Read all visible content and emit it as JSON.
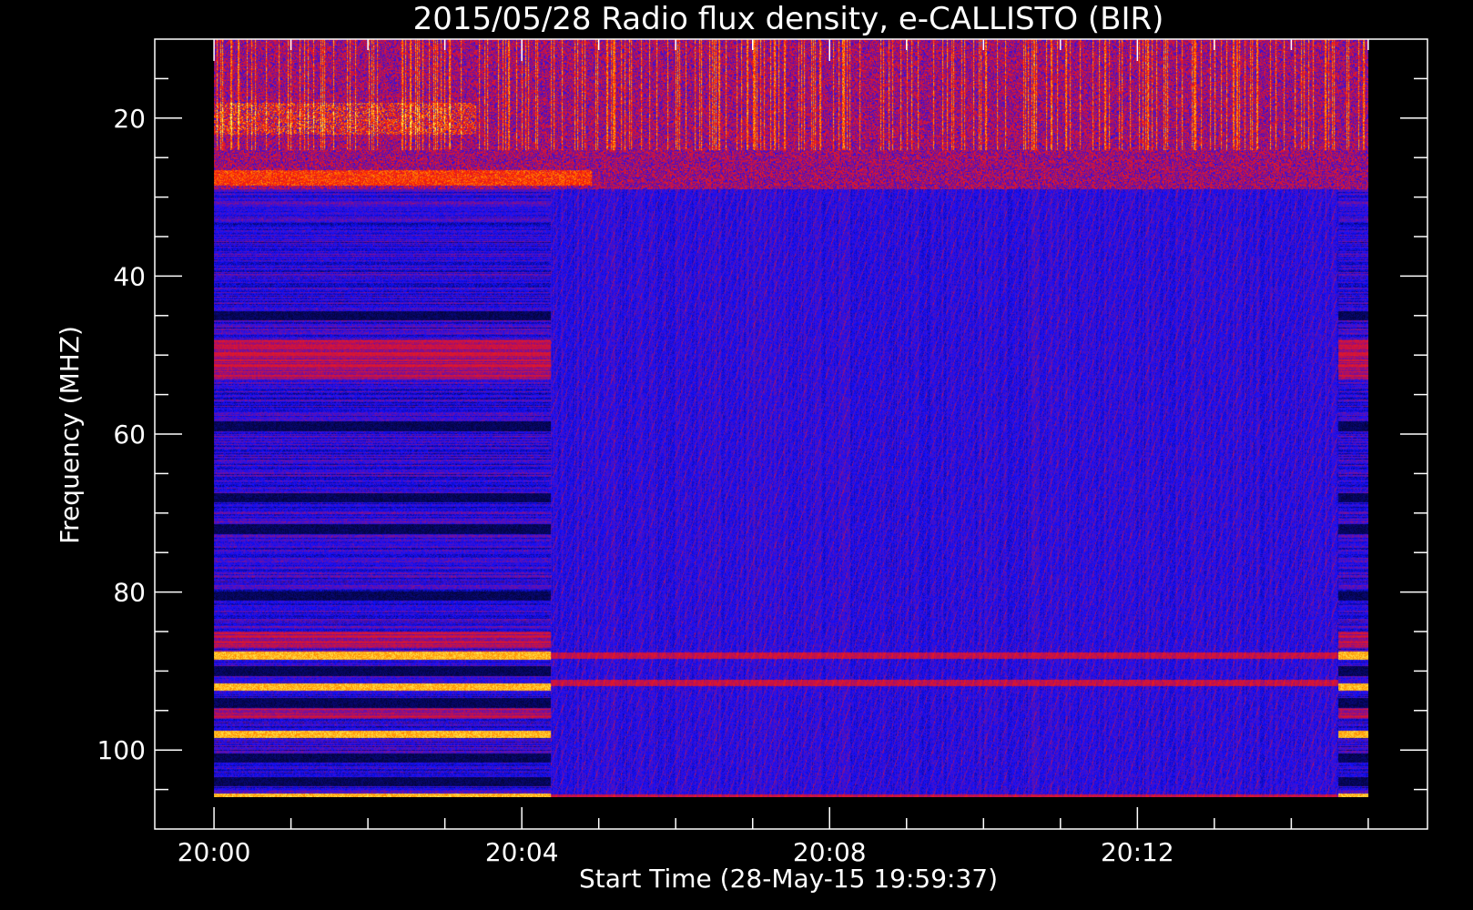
{
  "chart_data": {
    "type": "heatmap",
    "title": "2015/05/28  Radio flux density, e-CALLISTO (BIR)",
    "xlabel": "Start Time (28-May-15 19:59:37)",
    "ylabel": "Frequency (MHZ)",
    "x_ticks": [
      "20:00",
      "20:04",
      "20:08",
      "20:12"
    ],
    "y_ticks": [
      20,
      40,
      60,
      80,
      100
    ],
    "x_range_minutes": [
      -0.77,
      15.77
    ],
    "y_range_mhz": [
      10,
      110
    ],
    "data_range_minutes": [
      0.0,
      15.0
    ],
    "data_range_mhz": [
      10,
      106
    ],
    "colormap": [
      "#000000",
      "#1010ff",
      "#c01050",
      "#ff2000",
      "#ff9000",
      "#ffff60"
    ],
    "segments": [
      {
        "from_min": 0.0,
        "to_min": 4.37,
        "mode": "banded"
      },
      {
        "from_min": 4.37,
        "to_min": 14.6,
        "mode": "uniform"
      },
      {
        "from_min": 14.6,
        "to_min": 15.0,
        "mode": "banded"
      }
    ],
    "bright_lines_mhz": [
      88,
      92,
      98,
      106
    ],
    "dark_lines_mhz": [
      23,
      45,
      59,
      68,
      72,
      80.5,
      90,
      94,
      101,
      104
    ],
    "noisy_band_mhz": [
      10,
      29
    ]
  }
}
